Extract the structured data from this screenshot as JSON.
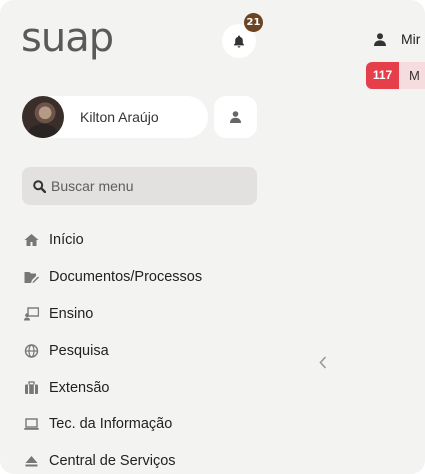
{
  "app": {
    "logo": "suap"
  },
  "notifications": {
    "count": "21"
  },
  "user": {
    "name": "Kilton Araújo"
  },
  "search": {
    "placeholder": "Buscar menu"
  },
  "menu": {
    "items": [
      {
        "label": "Início",
        "icon": "home-icon"
      },
      {
        "label": "Documentos/Processos",
        "icon": "folder-pen-icon"
      },
      {
        "label": "Ensino",
        "icon": "chalkboard-teacher-icon"
      },
      {
        "label": "Pesquisa",
        "icon": "globe-icon"
      },
      {
        "label": "Extensão",
        "icon": "briefcase-icon"
      },
      {
        "label": "Tec. da Informação",
        "icon": "laptop-icon"
      },
      {
        "label": "Central de Serviços",
        "icon": "eject-icon"
      }
    ]
  },
  "header": {
    "user_name_partial": "Mir"
  },
  "pending": {
    "count": "117",
    "label_partial": "M"
  },
  "colors": {
    "background": "#f3f3f1",
    "badge_brown": "#6b4423",
    "counter_red": "#e43f4b",
    "counter_bg": "#f6dcdc",
    "icon_gray": "#777777"
  }
}
